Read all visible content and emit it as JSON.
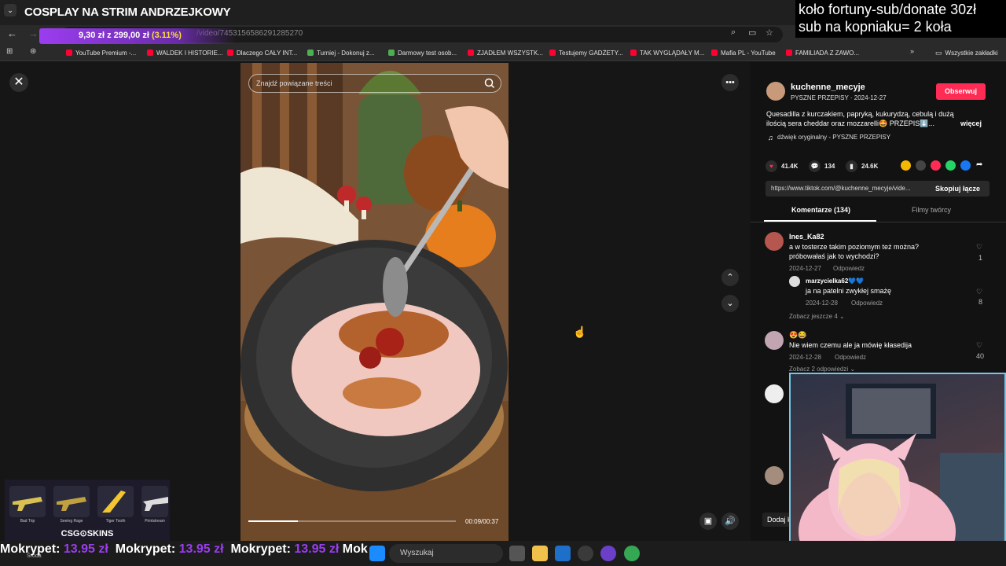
{
  "overlay": {
    "stream_title": "COSPLAY NA STRIM ANDRZEJKOWY",
    "donation_goal": {
      "text": "9,30 zł z 299,00 zł",
      "percent": "(3.11%)",
      "progress": 0.0311
    },
    "wheel_line1": "koło fortuny-sub/donate 30zł",
    "wheel_line2": "sub na kopniaku= 2 koła",
    "csgo_brand": "CSG⊙SKINS",
    "csgo_items": [
      "Bad Trip",
      "Seeing Rage",
      "Tiger Tooth",
      "Printstream"
    ],
    "ticker_text": "Mokrypet: ",
    "ticker_amount": "13.95 zł",
    "ticker_tail": "Mok"
  },
  "browser": {
    "url": "/video/7453156586291285270",
    "bookmarks": [
      "YouTube Premium -...",
      "WALDEK I HISTORIE...",
      "Dlaczego CAŁY INT...",
      "Turniej - Dokonuj z...",
      "Darmowy test osob...",
      "ZJADŁEM WSZYSTK...",
      "Testujemy GADŻETY...",
      "TAK WYGLĄDAŁY M...",
      "Mafia PL - YouTube",
      "FAMILIADA Z ZAWO..."
    ],
    "all_bookmarks": "Wszystkie zakładki"
  },
  "video": {
    "search_placeholder": "Znajdź powiązane treści",
    "time": "00:09/00:37",
    "progress": 0.24
  },
  "post": {
    "author": "kuchenne_mecyje",
    "subline": "PYSZNE PRZEPISY · 2024-12-27",
    "follow_label": "Obserwuj",
    "description": "Quesadilla z kurczakiem, papryką, kukurydzą, cebulą i dużą ilością sera cheddar oraz mozzarelli🤩 PRZEPIS⬇️...",
    "more_label": "więcej",
    "sound": "dźwięk oryginalny - PYSZNE PRZEPISY",
    "likes": "41.4K",
    "comments": "134",
    "saves": "24.6K",
    "link": "https://www.tiktok.com/@kuchenne_mecyje/vide...",
    "copy_label": "Skopiuj łącze",
    "tab_comments": "Komentarze (134)",
    "tab_creator": "Filmy twórcy",
    "add_comment": "Dodaj k"
  },
  "comments": [
    {
      "user": "Ines_Ka82",
      "text1": "a w tosterze takim poziomym też można?",
      "text2": "próbowałaś jak to wychodzi?",
      "date": "2024-12-27",
      "reply": "Odpowiedz",
      "likes": "1"
    },
    {
      "user": "marzycielka62💙💙",
      "text1": "ja na patelni zwykłej smażę",
      "date": "2024-12-28",
      "reply": "Odpowiedz",
      "likes": "8"
    },
    {
      "view_more": "Zobacz jeszcze 4 ⌄"
    },
    {
      "user": "😍😂",
      "text1": "Nie wiem czemu ale ja mówię kłasedija",
      "date": "2024-12-28",
      "reply": "Odpowiedz",
      "likes": "40",
      "view_more": "Zobacz 2 odpowiedzi ⌄"
    }
  ],
  "taskbar": {
    "search_placeholder": "Wyszukaj",
    "weather_label": "Środa"
  },
  "colors": {
    "accent": "#fe2c55",
    "donate": "#9b3df0",
    "panel": "#121212"
  }
}
